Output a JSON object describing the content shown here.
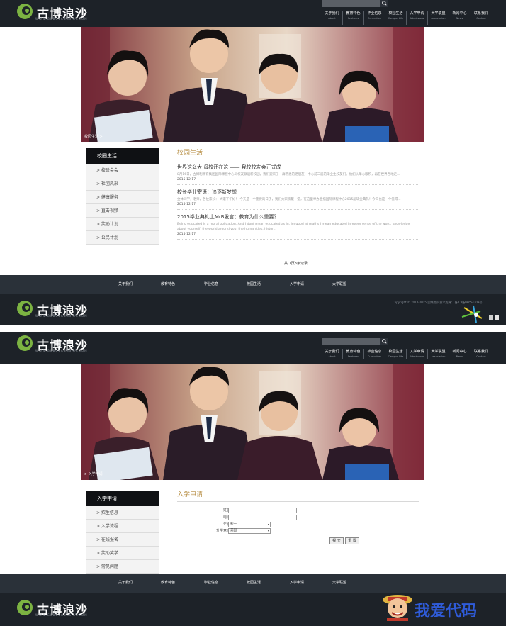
{
  "site": {
    "logo_text": "古博浪沙",
    "logo_url": "WWW.GUBOLANGSHA.COM",
    "brand_color": "#7cb342",
    "nav": [
      {
        "cn": "关于我们",
        "en": "About"
      },
      {
        "cn": "教育特色",
        "en": "Features"
      },
      {
        "cn": "毕业信息",
        "en": "Curriculum"
      },
      {
        "cn": "校园生活",
        "en": "Campus Life"
      },
      {
        "cn": "入学申请",
        "en": "Admissions"
      },
      {
        "cn": "大学联盟",
        "en": "Association"
      },
      {
        "cn": "新闻中心",
        "en": "News"
      },
      {
        "cn": "联系我们",
        "en": "Contact"
      }
    ],
    "footer_nav": [
      "关于我们",
      "教育特色",
      "毕业信息",
      "校园生活",
      "入学申请",
      "大学联盟"
    ],
    "copyright": "Copyright © 2014-2015 古博浪沙 技术支持：",
    "copyright_tail": "备ICP备08654209号"
  },
  "page1": {
    "breadcrumb": "校园生活 >",
    "sidebar_title": "校园生活",
    "sidebar_items": [
      "> 校联会会",
      "> 社团风采",
      "> 健康服务",
      "> 直击视频",
      "> 奖励计划",
      "> 公民计划"
    ],
    "main_title": "校园生活",
    "articles": [
      {
        "title": "世界这么大 母校还在这 —— 我校校友会正式成",
        "summary": "8月16日，古博利教育集团国际课程中心同校友联谊新校园，我们迎来了一群熟悉的老朋友：中心前三届的毕业生校友们。他们从华心眼积，再在世界各地走...",
        "date": "2015-12-17"
      },
      {
        "title": "校长毕业寄语：追逐新梦想",
        "summary": "全体同学，老师，各位家长： 大家下午好！ 今天是一个重要的日子，我们大家欢聚一堂，在这里举办直播国际课程中心2015届毕业典礼！今天也是一个值得...",
        "date": "2015-12-17"
      },
      {
        "title": "2015毕业典礼上MrB发言：教育为什么重要？",
        "summary": "Being educated is a moral obligation. And I dont mean educated as in, im good at maths I mean educated in every sense of the word, knowledge about yourself, the world around you, the humanities, histor...",
        "date": "2015-12-17"
      }
    ],
    "pager": "共 1页3条记录"
  },
  "page2": {
    "breadcrumb": "> 入学申请",
    "sidebar_title": "入学申请",
    "sidebar_items": [
      "> 招生信息",
      "> 入学流程",
      "> 在线报名",
      "> 奖助奖学",
      "> 常见问题"
    ],
    "main_title": "入学申请",
    "form": {
      "name_label": "姓名：",
      "phone_label": "电话：",
      "grade_label": "年级：",
      "grade_value": "初一",
      "destination_label": "升学意向：",
      "destination_value": "美国",
      "submit_label": "提 交",
      "reset_label": "重 置"
    }
  },
  "watermark_text": "我爱代码"
}
